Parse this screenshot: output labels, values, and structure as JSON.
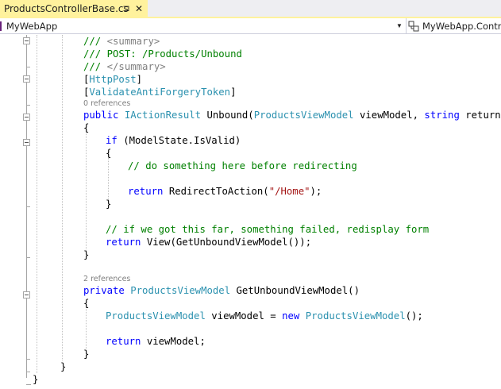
{
  "tab": {
    "title": "ProductsControllerBase.cs",
    "pin_glyph": "⊐",
    "close_glyph": "✕",
    "color": "#fff29d"
  },
  "navbar": {
    "project": "MyWebApp",
    "type": "MyWebApp.Contro"
  },
  "colors": {
    "keyword": "#0000ff",
    "comment": "#008000",
    "type": "#2b91af",
    "string": "#a31515",
    "codelens": "#7f7f7f"
  },
  "code": {
    "l1": [
      "/// ",
      "<summary>"
    ],
    "l2": [
      "/// POST: /Products/Unbound"
    ],
    "l3": [
      "/// ",
      "</summary>"
    ],
    "l4": [
      "[",
      "HttpPost",
      "]"
    ],
    "l5": [
      "[",
      "ValidateAntiForgeryToken",
      "]"
    ],
    "lens1": "0 references",
    "l6": [
      "public ",
      "IActionResult",
      " Unbound(",
      "ProductsViewModel",
      " viewModel, ",
      "string",
      " returnUrl)"
    ],
    "l7": [
      "{"
    ],
    "l8": [
      "if",
      " (ModelState.IsValid)"
    ],
    "l9": [
      "{"
    ],
    "l10": [
      "// do something here before redirecting"
    ],
    "l11": [
      "return",
      " RedirectToAction(",
      "\"/Home\"",
      ");"
    ],
    "l12": [
      "}"
    ],
    "l13": [
      "// if we got this far, something failed, redisplay form"
    ],
    "l14": [
      "return",
      " View(GetUnboundViewModel());"
    ],
    "l15": [
      "}"
    ],
    "lens2": "2 references",
    "l16": [
      "private ",
      "ProductsViewModel",
      " GetUnboundViewModel()"
    ],
    "l17": [
      "{"
    ],
    "l18": [
      "ProductsViewModel",
      " viewModel = ",
      "new ",
      "ProductsViewModel",
      "();"
    ],
    "l19": [
      "return",
      " viewModel;"
    ],
    "l20": [
      "}"
    ],
    "l21": [
      "}"
    ],
    "l22": [
      "}"
    ]
  }
}
